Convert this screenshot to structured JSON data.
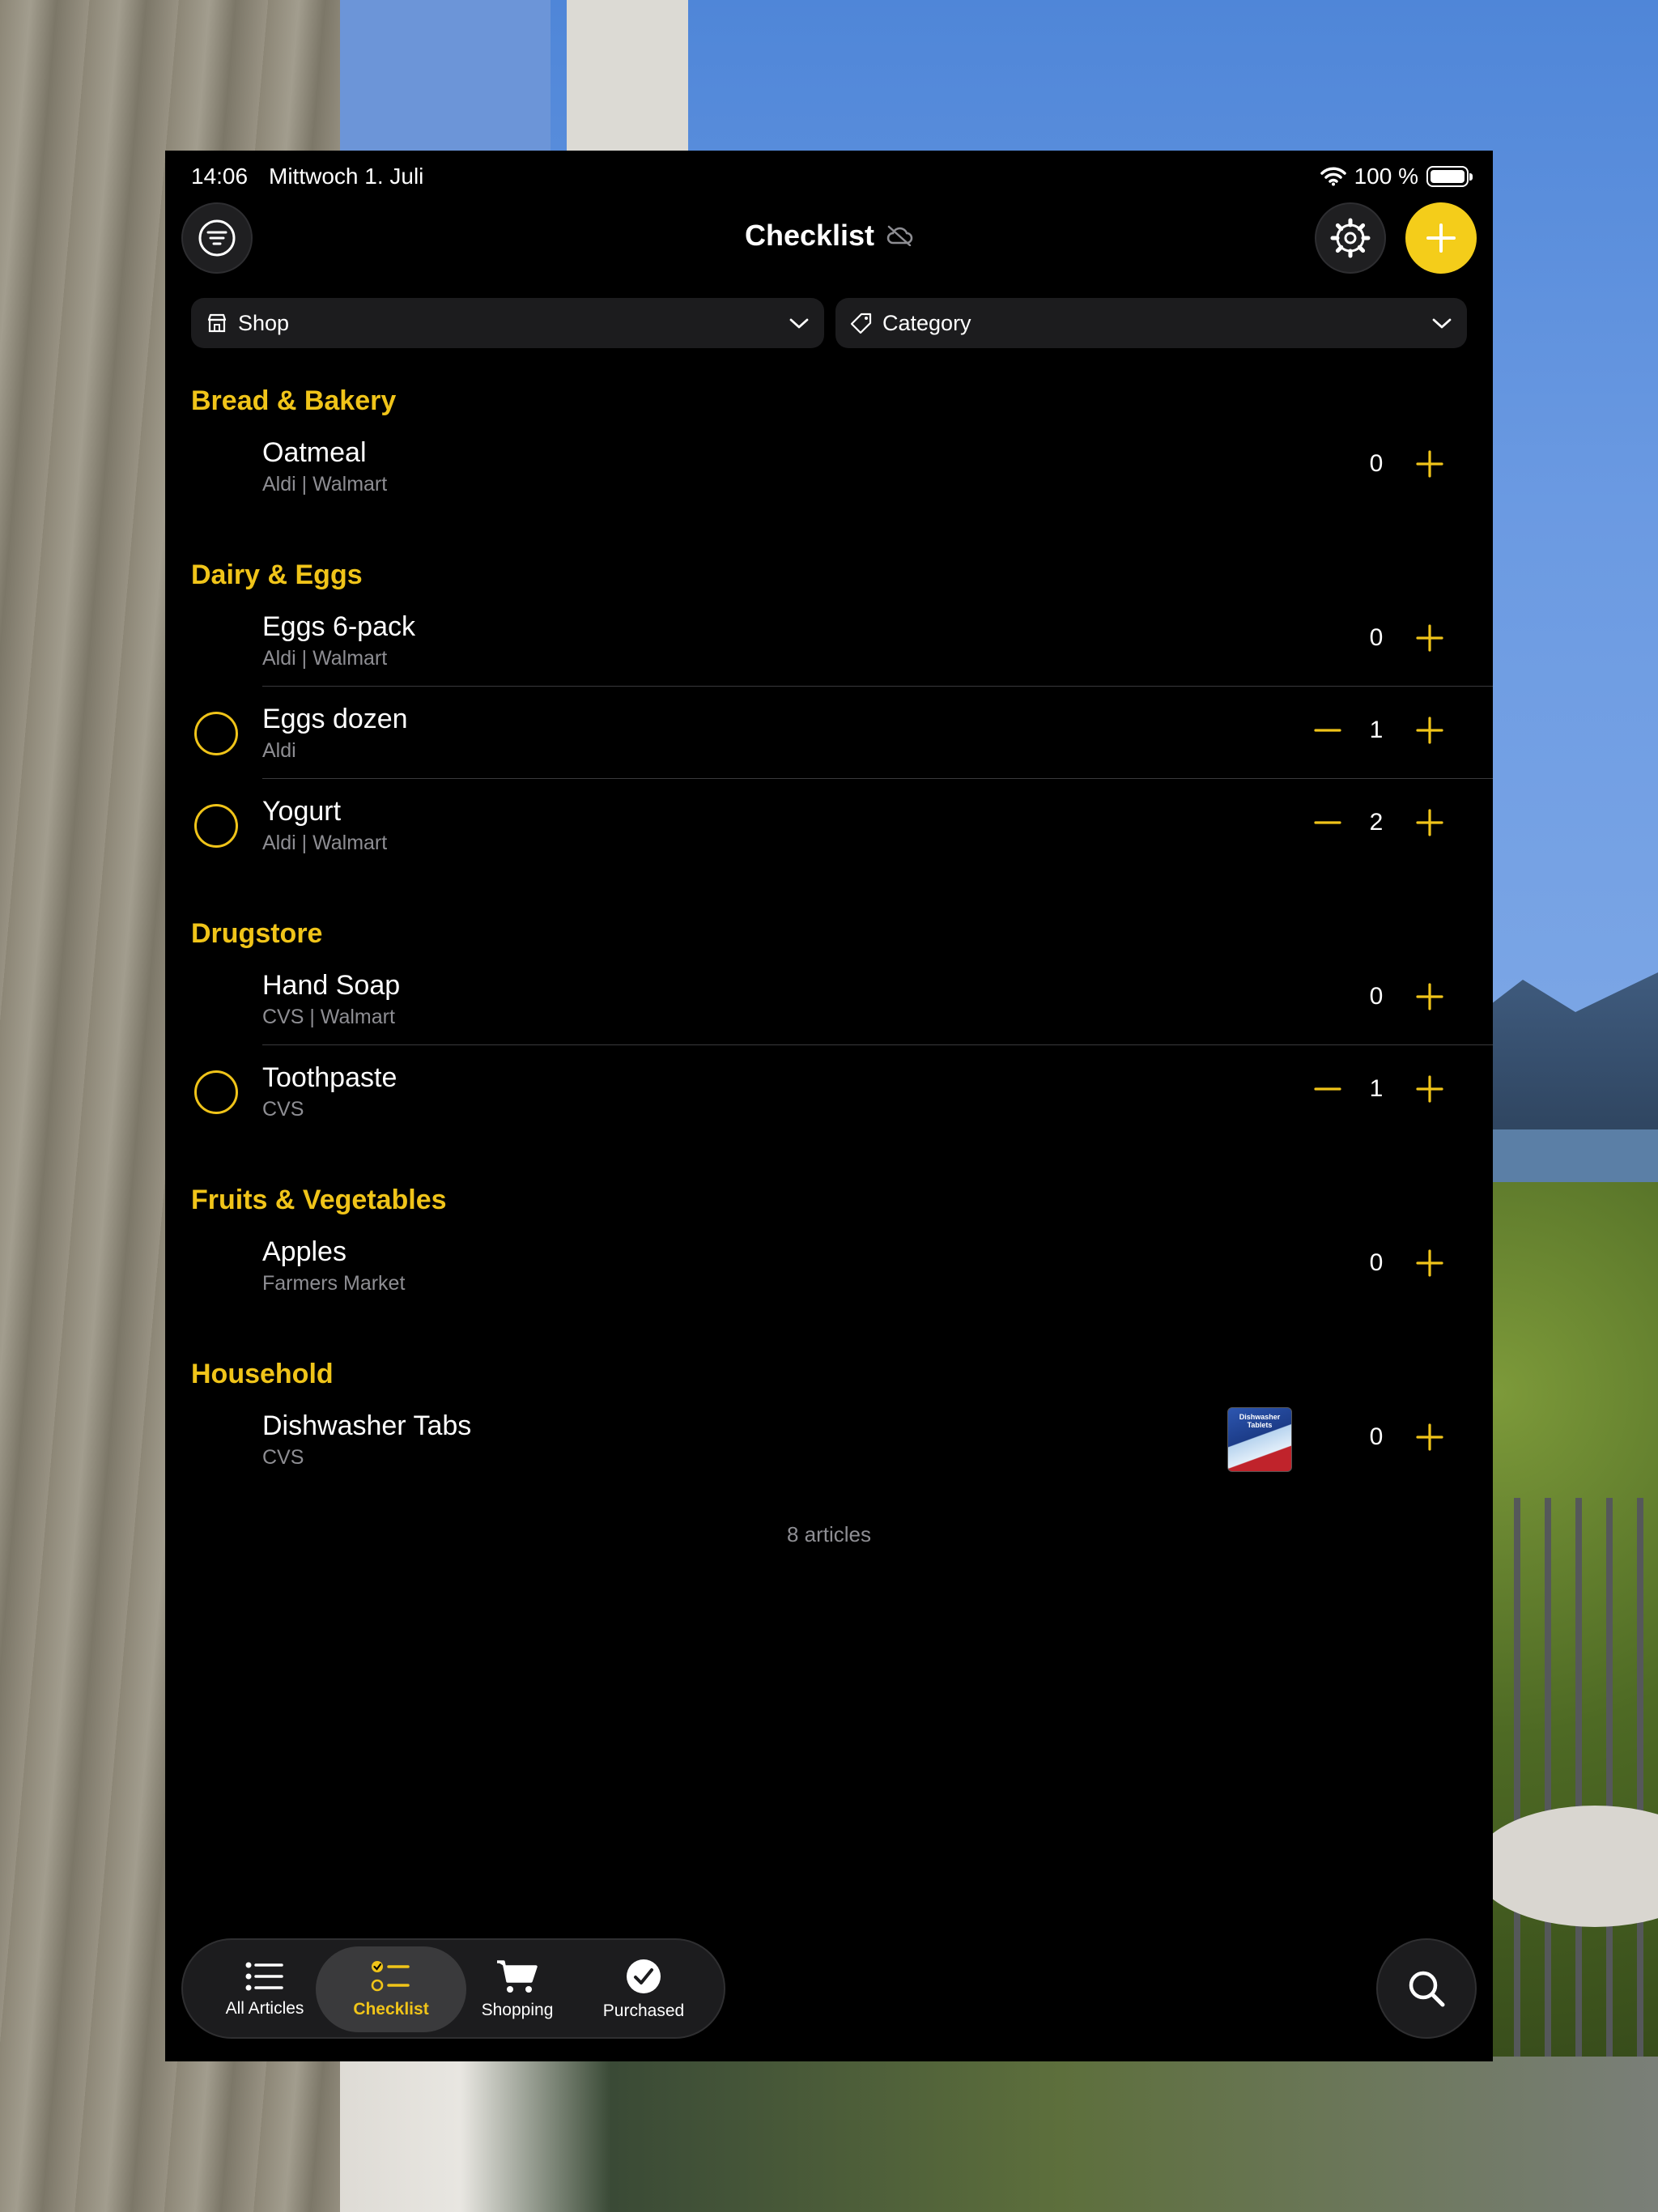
{
  "status_bar": {
    "time": "14:06",
    "date": "Mittwoch 1. Juli",
    "battery": "100 %"
  },
  "header": {
    "title": "Checklist"
  },
  "filters": {
    "shop_label": "Shop",
    "category_label": "Category"
  },
  "sections": [
    {
      "title": "Bread & Bakery",
      "items": [
        {
          "name": "Oatmeal",
          "shops": "Aldi | Walmart",
          "qty": "0"
        }
      ]
    },
    {
      "title": "Dairy & Eggs",
      "items": [
        {
          "name": "Eggs 6-pack",
          "shops": "Aldi | Walmart",
          "qty": "0"
        },
        {
          "name": "Eggs dozen",
          "shops": "Aldi",
          "qty": "1"
        },
        {
          "name": "Yogurt",
          "shops": "Aldi | Walmart",
          "qty": "2"
        }
      ]
    },
    {
      "title": "Drugstore",
      "items": [
        {
          "name": "Hand Soap",
          "shops": "CVS | Walmart",
          "qty": "0"
        },
        {
          "name": "Toothpaste",
          "shops": "CVS",
          "qty": "1"
        }
      ]
    },
    {
      "title": "Fruits & Vegetables",
      "items": [
        {
          "name": "Apples",
          "shops": "Farmers Market",
          "qty": "0"
        }
      ]
    },
    {
      "title": "Household",
      "items": [
        {
          "name": "Dishwasher Tabs",
          "shops": "CVS",
          "qty": "0",
          "thumb_text": "Dishwasher Tablets"
        }
      ]
    }
  ],
  "footer": {
    "count": "8 articles"
  },
  "tabs": [
    {
      "label": "All Articles"
    },
    {
      "label": "Checklist"
    },
    {
      "label": "Shopping"
    },
    {
      "label": "Purchased"
    }
  ],
  "colors": {
    "accent": "#f0c419",
    "add_button": "#f4cd1a",
    "background": "#000000",
    "secondary_text": "#8e8e93"
  },
  "icons": {
    "filter": "filter-lines-icon",
    "settings": "gear-icon",
    "add": "plus-icon",
    "cloud": "cloud-off-icon",
    "search": "search-icon"
  }
}
